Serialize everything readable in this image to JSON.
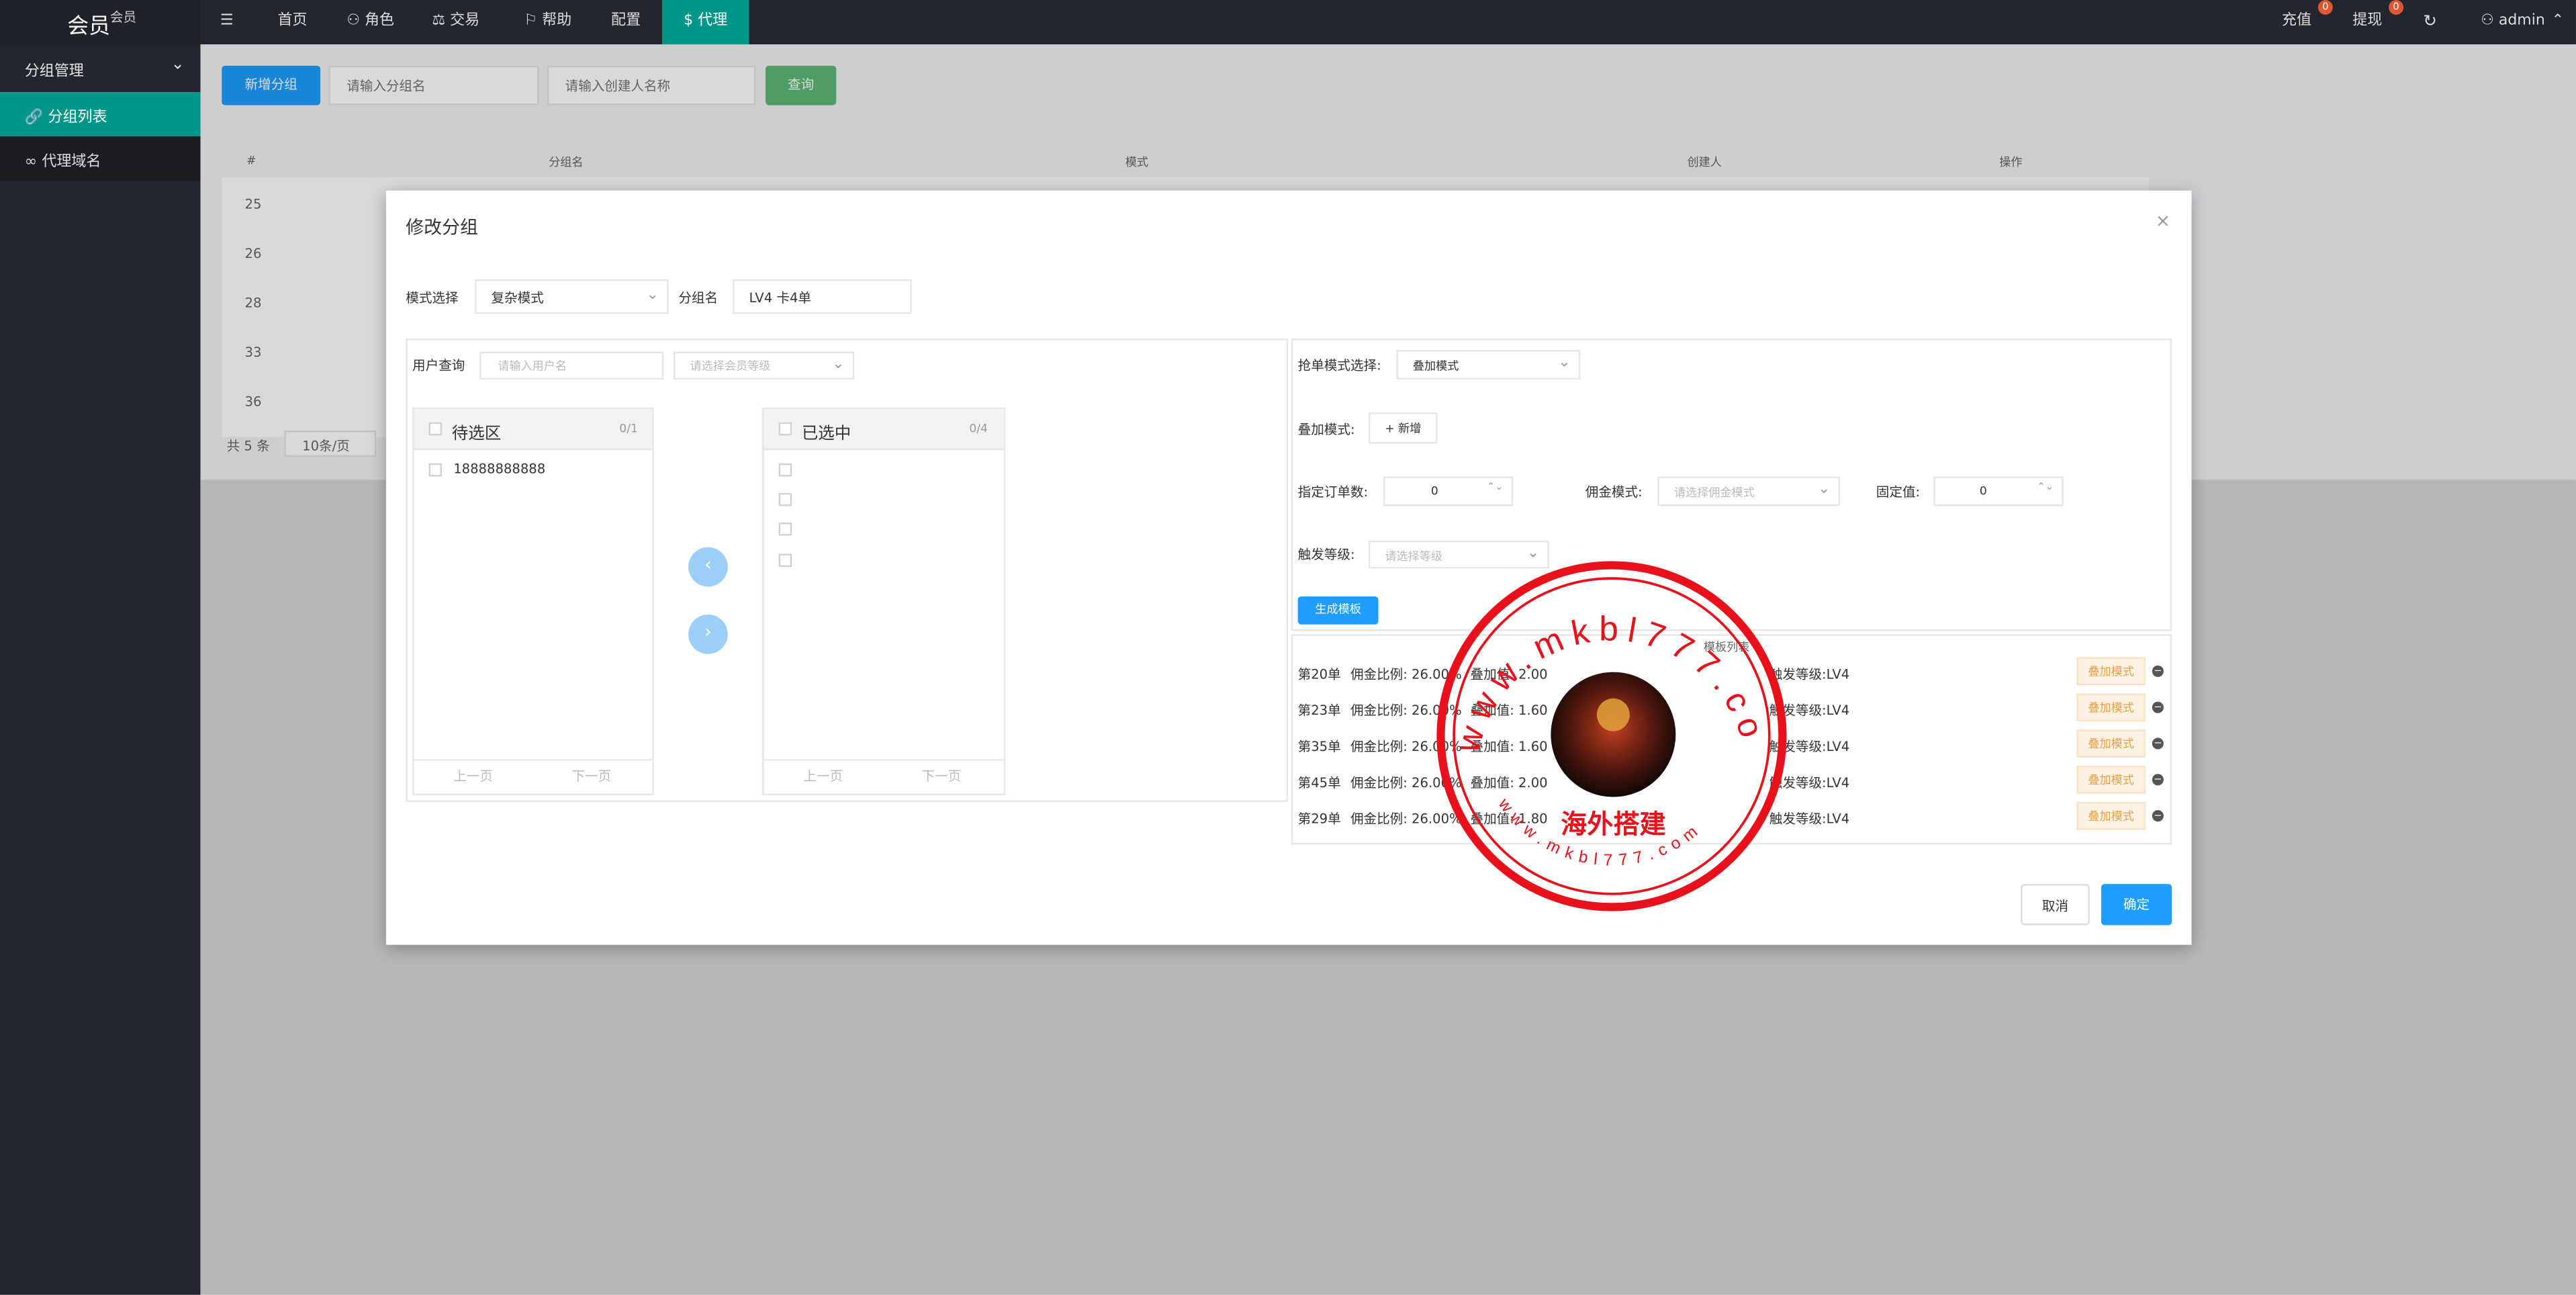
{
  "app": {
    "title": "会员",
    "subtitle": "会员"
  },
  "sidebar": {
    "group": "分组管理",
    "items": [
      {
        "label": "分组列表"
      },
      {
        "label": "代理域名"
      }
    ]
  },
  "topnav": {
    "items": [
      "首页",
      "角色",
      "交易",
      "帮助",
      "配置",
      "代理"
    ],
    "recharge": "充值",
    "recharge_badge": "0",
    "withdraw": "提现",
    "withdraw_badge": "0",
    "user": "admin"
  },
  "toolbar": {
    "add_label": "新增分组",
    "group_placeholder": "请输入分组名",
    "creator_placeholder": "请输入创建人名称",
    "query_label": "查询"
  },
  "table": {
    "headers": [
      "#",
      "分组名",
      "模式",
      "创建人",
      "操作"
    ],
    "rows": [
      "25",
      "26",
      "28",
      "33",
      "36"
    ],
    "total": "共 5 条",
    "page_size": "10条/页"
  },
  "modal": {
    "title": "修改分组",
    "mode_label": "模式选择",
    "mode_value": "复杂模式",
    "name_label": "分组名",
    "name_value": "LV4 卡4单",
    "user_query_label": "用户查询",
    "username_placeholder": "请输入用户名",
    "level_placeholder": "请选择会员等级",
    "left_panel": {
      "title": "待选区",
      "count": "0/1",
      "items": [
        "18888888888"
      ],
      "prev": "上一页",
      "next": "下一页"
    },
    "right_panel": {
      "title": "已选中",
      "count": "0/4",
      "prev": "上一页",
      "next": "下一页"
    },
    "grab_mode_label": "抢单模式选择:",
    "grab_mode_value": "叠加模式",
    "stack_mode_label": "叠加模式:",
    "add_label": "+ 新增",
    "order_count_label": "指定订单数:",
    "order_count_value": "0",
    "commission_mode_label": "佣金模式:",
    "commission_mode_placeholder": "请选择佣金模式",
    "fixed_label": "固定值:",
    "fixed_value": "0",
    "trigger_level_label": "触发等级:",
    "trigger_level_placeholder": "请选择等级",
    "generate_label": "生成模板",
    "template_list_title": "模板列表",
    "templates": [
      {
        "order": "第20单",
        "ratio": "佣金比例: 26.00%",
        "add": "叠加值: 2.00",
        "level": "触发等级:LV4",
        "mode": "叠加模式"
      },
      {
        "order": "第23单",
        "ratio": "佣金比例: 26.00%",
        "add": "叠加值: 1.60",
        "level": "触发等级:LV4",
        "mode": "叠加模式"
      },
      {
        "order": "第35单",
        "ratio": "佣金比例: 26.00%",
        "add": "叠加值: 1.60",
        "level": "触发等级:LV4",
        "mode": "叠加模式"
      },
      {
        "order": "第45单",
        "ratio": "佣金比例: 26.00%",
        "add": "叠加值: 2.00",
        "level": "触发等级:LV4",
        "mode": "叠加模式"
      },
      {
        "order": "第29单",
        "ratio": "佣金比例: 26.00%",
        "add": "叠加值: 1.80",
        "level": "触发等级:LV4",
        "mode": "叠加模式"
      }
    ],
    "cancel_label": "取消",
    "confirm_label": "确定"
  },
  "watermark": {
    "top_text": "www.mkbl777.com",
    "center_text": "海外搭建",
    "bottom_text": "www.mkbl777.com"
  },
  "colors": {
    "teal": "#009688",
    "blue": "#1e9fff",
    "green": "#5fb878",
    "dark": "#23262e",
    "stamp_red": "#e8101a"
  }
}
